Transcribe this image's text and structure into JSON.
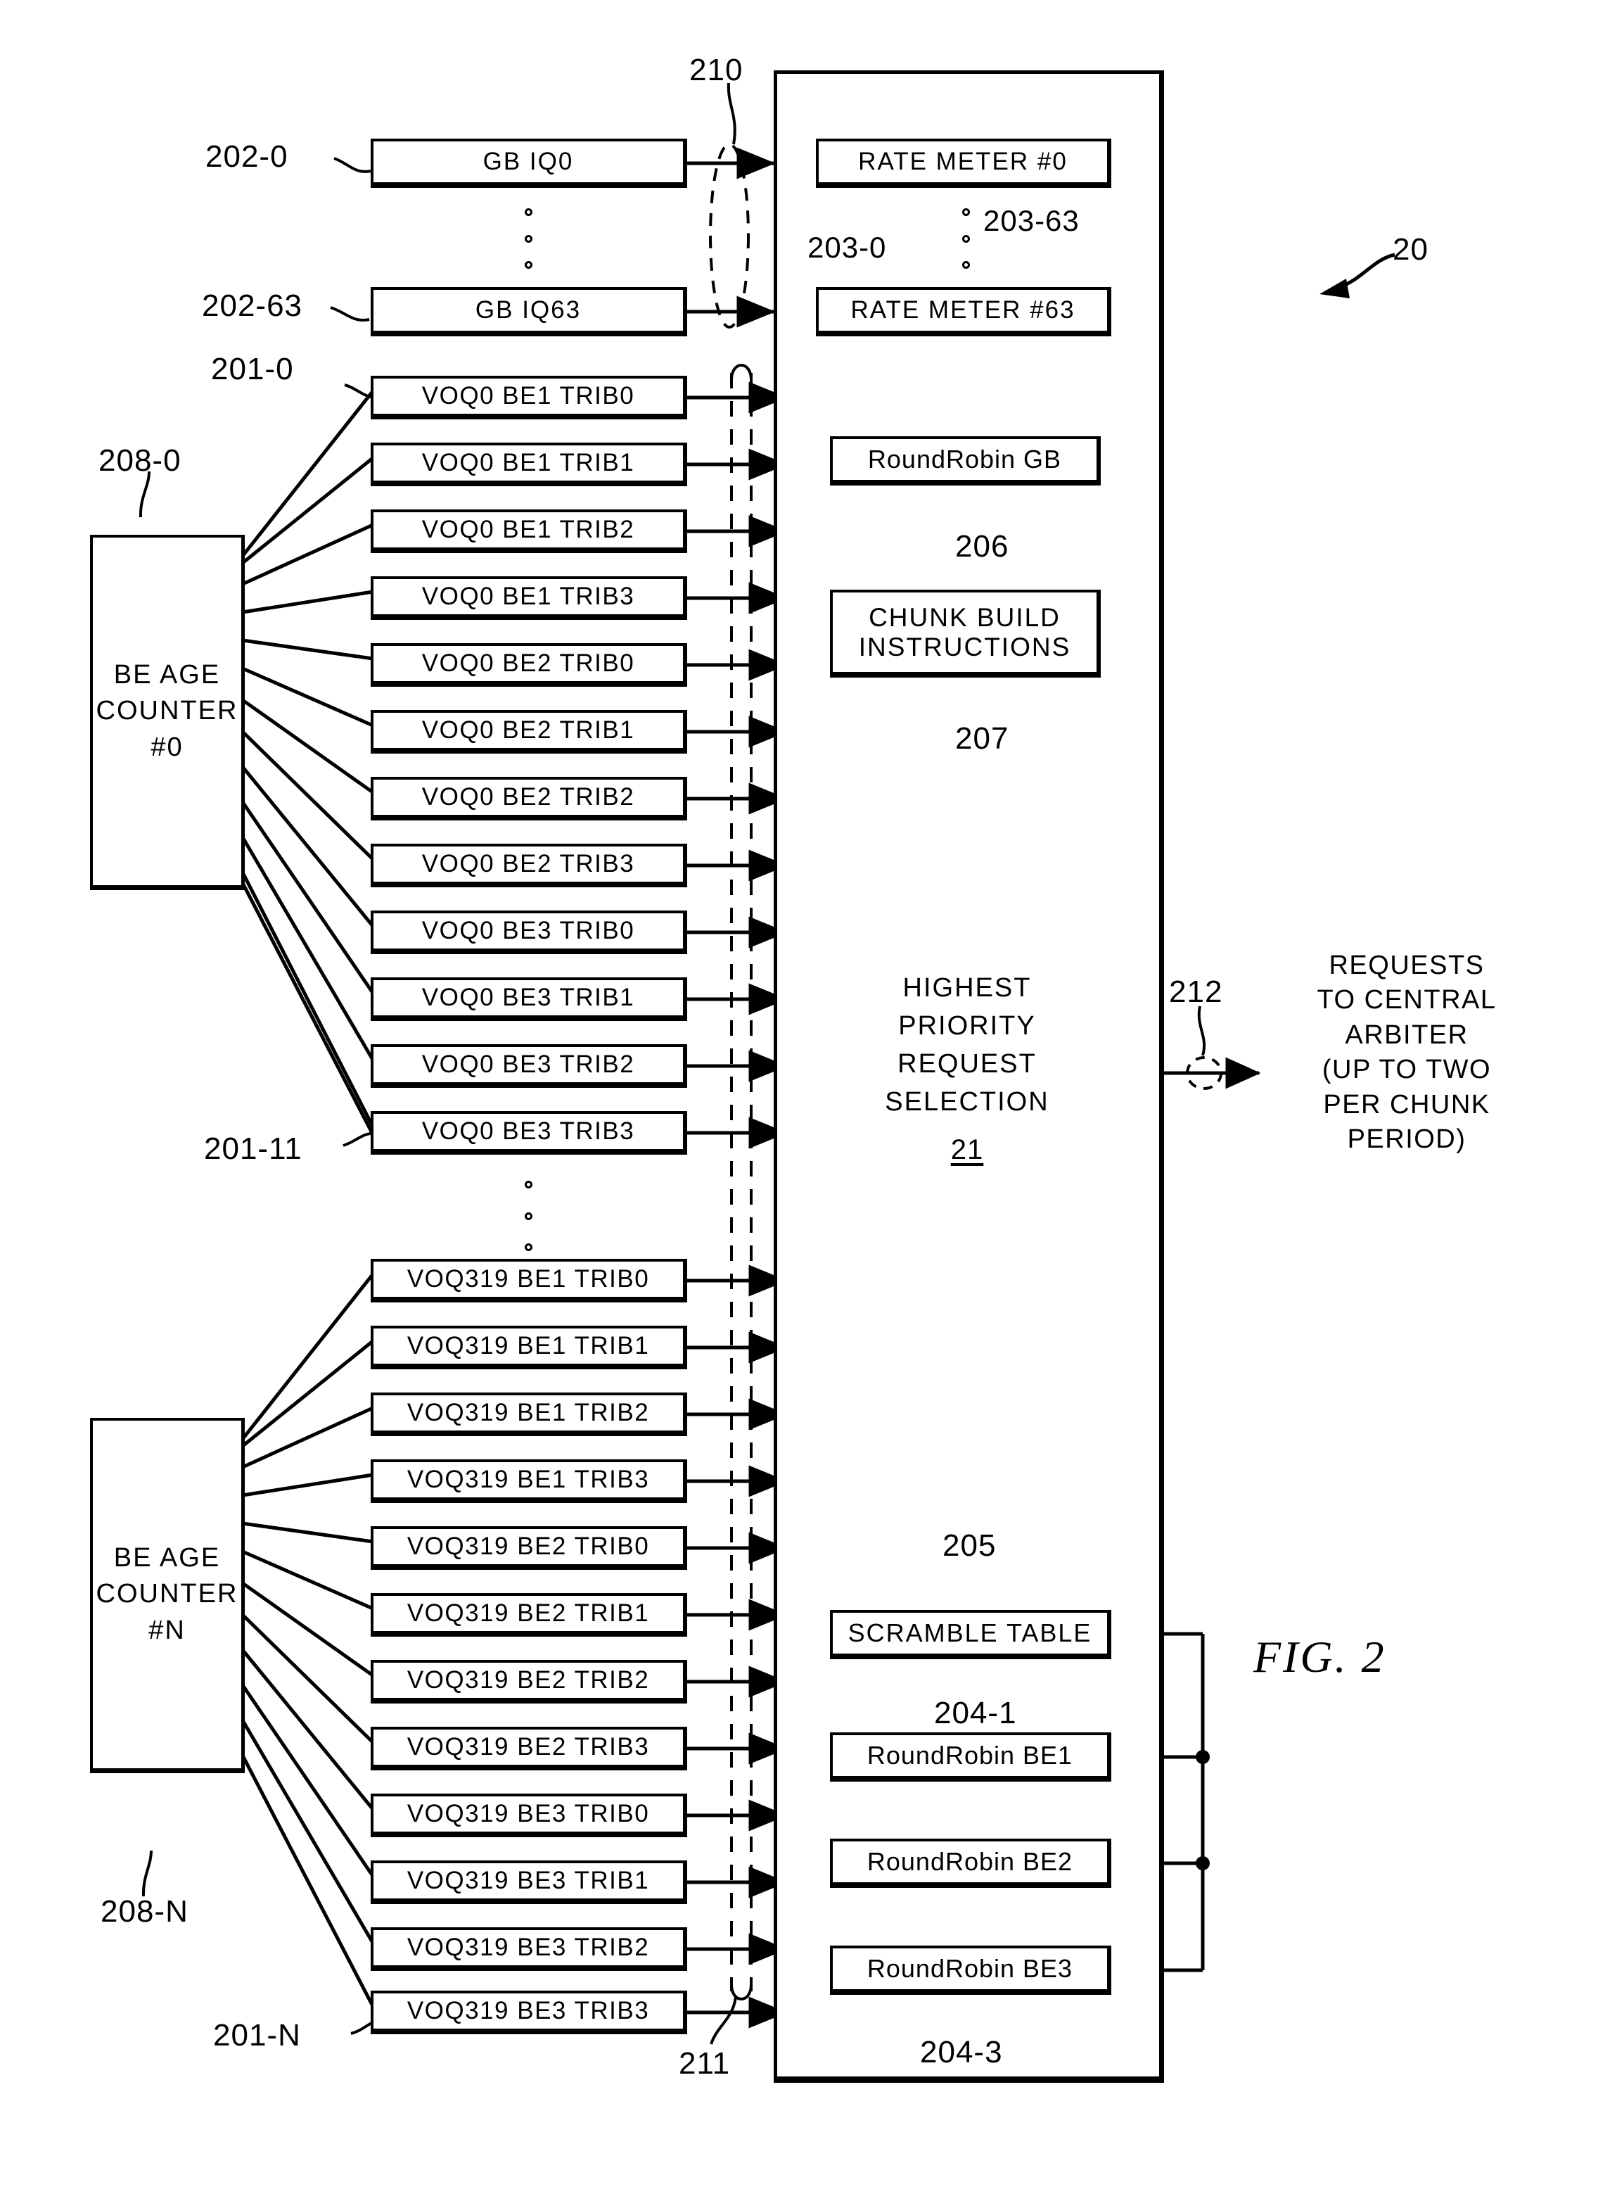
{
  "figure": {
    "label": "FIG.  2",
    "system_ref": "20"
  },
  "gb_queues": {
    "ref_first": "202-0",
    "ref_last": "202-63",
    "items": [
      {
        "label": "GB IQ0"
      },
      {
        "label": "GB IQ63"
      }
    ]
  },
  "rate_meters": {
    "ref_first": "203-0",
    "ref_last": "203-63",
    "items": [
      {
        "label": "RATE METER #0"
      },
      {
        "label": "RATE METER #63"
      }
    ]
  },
  "bus_markers": {
    "gb_bus": "210",
    "be_bus": "211",
    "output_bus": "212"
  },
  "selector_panel": {
    "title": "HIGHEST\nPRIORITY\nREQUEST\nSELECTION",
    "number": "21"
  },
  "round_robin_gb": {
    "label": "RoundRobin GB",
    "ref": "206"
  },
  "chunk_build": {
    "label": "CHUNK BUILD\nINSTRUCTIONS",
    "ref": "207"
  },
  "scramble_table": {
    "label": "SCRAMBLE TABLE",
    "ref": "205"
  },
  "round_robin_be": {
    "ref_first": "204-1",
    "ref_last": "204-3",
    "items": [
      {
        "label": "RoundRobin BE1"
      },
      {
        "label": "RoundRobin BE2"
      },
      {
        "label": "RoundRobin BE3"
      }
    ]
  },
  "output": {
    "text": "REQUESTS\nTO CENTRAL\nARBITER\n(UP TO TWO\nPER CHUNK\nPERIOD)"
  },
  "age_counters": {
    "items": [
      {
        "label": "BE AGE\nCOUNTER\n#0",
        "ref": "208-0"
      },
      {
        "label": "BE AGE\nCOUNTER\n#N",
        "ref": "208-N"
      }
    ]
  },
  "voq_group_top": {
    "ref_first": "201-0",
    "ref_last": "201-11",
    "items": [
      {
        "label": "VOQ0 BE1 TRIB0"
      },
      {
        "label": "VOQ0 BE1 TRIB1"
      },
      {
        "label": "VOQ0 BE1 TRIB2"
      },
      {
        "label": "VOQ0 BE1 TRIB3"
      },
      {
        "label": "VOQ0 BE2 TRIB0"
      },
      {
        "label": "VOQ0 BE2 TRIB1"
      },
      {
        "label": "VOQ0 BE2 TRIB2"
      },
      {
        "label": "VOQ0 BE2 TRIB3"
      },
      {
        "label": "VOQ0 BE3 TRIB0"
      },
      {
        "label": "VOQ0 BE3 TRIB1"
      },
      {
        "label": "VOQ0 BE3 TRIB2"
      },
      {
        "label": "VOQ0 BE3 TRIB3"
      }
    ]
  },
  "voq_group_bottom": {
    "ref_last": "201-N",
    "items": [
      {
        "label": "VOQ319 BE1 TRIB0"
      },
      {
        "label": "VOQ319 BE1 TRIB1"
      },
      {
        "label": "VOQ319 BE1 TRIB2"
      },
      {
        "label": "VOQ319 BE1 TRIB3"
      },
      {
        "label": "VOQ319 BE2 TRIB0"
      },
      {
        "label": "VOQ319 BE2 TRIB1"
      },
      {
        "label": "VOQ319 BE2 TRIB2"
      },
      {
        "label": "VOQ319 BE2 TRIB3"
      },
      {
        "label": "VOQ319 BE3 TRIB0"
      },
      {
        "label": "VOQ319 BE3 TRIB1"
      },
      {
        "label": "VOQ319 BE3 TRIB2"
      },
      {
        "label": "VOQ319 BE3 TRIB3"
      }
    ]
  }
}
